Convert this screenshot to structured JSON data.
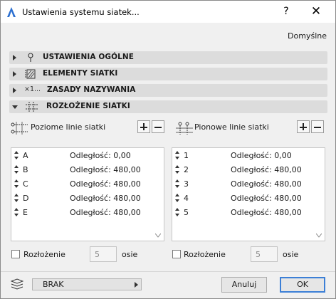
{
  "window": {
    "title": "Ustawienia systemu siatek...",
    "help_label": "?",
    "close_label": "✕"
  },
  "header": {
    "defaults_label": "Domyślne"
  },
  "sections": [
    {
      "label": "USTAWIENIA OGÓLNE",
      "icon": "pin-icon",
      "expanded": false
    },
    {
      "label": "ELEMENTY SIATKI",
      "icon": "grid-element-icon",
      "expanded": false
    },
    {
      "label": "ZASADY NAZYWANIA",
      "icon": "naming-icon",
      "icon_text": "×1...",
      "expanded": false
    },
    {
      "label": "ROZŁOŻENIE SIATKI",
      "icon": "grid-layout-icon",
      "expanded": true
    }
  ],
  "horizontal": {
    "header_label": "Poziome linie siatki",
    "rows": [
      {
        "name": "A",
        "distance": "Odległość: 0,00"
      },
      {
        "name": "B",
        "distance": "Odległość: 480,00"
      },
      {
        "name": "C",
        "distance": "Odległość: 480,00"
      },
      {
        "name": "D",
        "distance": "Odległość: 480,00"
      },
      {
        "name": "E",
        "distance": "Odległość: 480,00"
      }
    ],
    "distribution_label": "Rozłożenie",
    "axis_count": "5",
    "axis_label": "osie"
  },
  "vertical": {
    "header_label": "Pionowe linie siatki",
    "rows": [
      {
        "name": "1",
        "distance": "Odległość: 0,00"
      },
      {
        "name": "2",
        "distance": "Odległość: 480,00"
      },
      {
        "name": "3",
        "distance": "Odległość: 480,00"
      },
      {
        "name": "4",
        "distance": "Odległość: 480,00"
      },
      {
        "name": "5",
        "distance": "Odległość: 480,00"
      }
    ],
    "distribution_label": "Rozłożenie",
    "axis_count": "5",
    "axis_label": "osie"
  },
  "footer": {
    "layer_value": "BRAK",
    "cancel_label": "Anuluj",
    "ok_label": "OK"
  },
  "colors": {
    "accent": "#3c7fd6",
    "section_bg": "#dcdcdc",
    "window_bg": "#f0f0f0"
  }
}
